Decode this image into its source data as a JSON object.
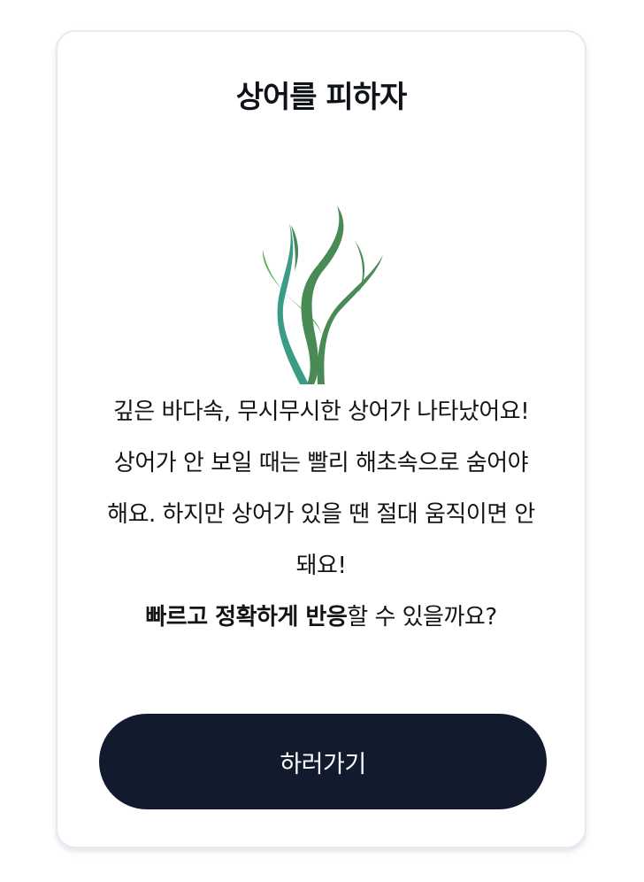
{
  "card": {
    "title": "상어를 피하자",
    "description": {
      "line1": "깊은 바다속, 무시무시한 상어가 나타났어요!",
      "line2": "상어가 안 보일 때는 빨리 해초속으로 숨어야 해요. 하지만 상어가 있을 땐 절대 움직이면 안 돼요!",
      "line3_bold": "빠르고 정확하게 반응",
      "line3_rest": "할 수 있을까요?"
    },
    "button_label": "하러가기"
  },
  "illustration": {
    "icon": "seaweed-icon",
    "colors": {
      "light_green": "#5fb35a",
      "teal": "#3a9c86",
      "dark_green": "#4a8a55"
    }
  },
  "colors": {
    "button_bg": "#121a2e",
    "card_border": "#e6e8f2"
  }
}
